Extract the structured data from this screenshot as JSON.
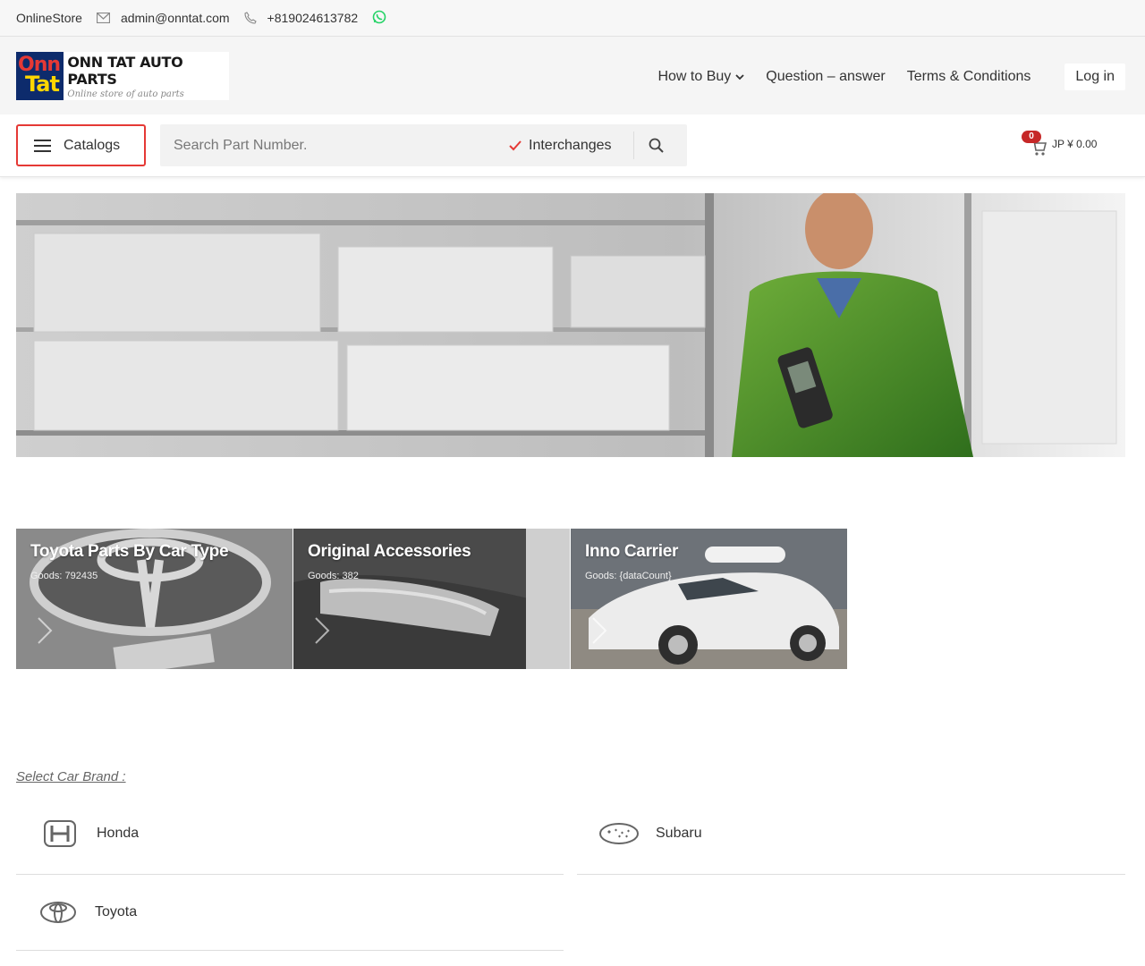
{
  "topbar": {
    "store_name": "OnlineStore",
    "email": "admin@onntat.com",
    "phone": "+819024613782"
  },
  "logo": {
    "badge_line1": "Onn",
    "badge_line2": "Tat",
    "title": "ONN TAT AUTO PARTS",
    "subtitle": "Online store of auto parts"
  },
  "nav": {
    "items": [
      "How to Buy",
      "Question – answer",
      "Terms & Conditions"
    ],
    "login": "Log in"
  },
  "search": {
    "catalogs_label": "Catalogs",
    "placeholder": "Search Part Number.",
    "interchanges_label": "Interchanges",
    "interchanges_checked": true
  },
  "cart": {
    "count": "0",
    "total": "JP ¥ 0.00"
  },
  "categories": [
    {
      "title": "Toyota Parts By Car Type",
      "goods": "Goods: 792435"
    },
    {
      "title": "Original Accessories",
      "goods": "Goods: 382"
    },
    {
      "title": "Inno Carrier",
      "goods": "Goods: {dataCount}"
    }
  ],
  "brands": {
    "heading": "Select Car Brand :",
    "items": [
      "Honda",
      "Subaru",
      "Toyota"
    ]
  },
  "colors": {
    "accent": "#e53935",
    "badge": "#c62828",
    "whatsapp": "#25d366",
    "logo_navy": "#0d2b6c"
  }
}
